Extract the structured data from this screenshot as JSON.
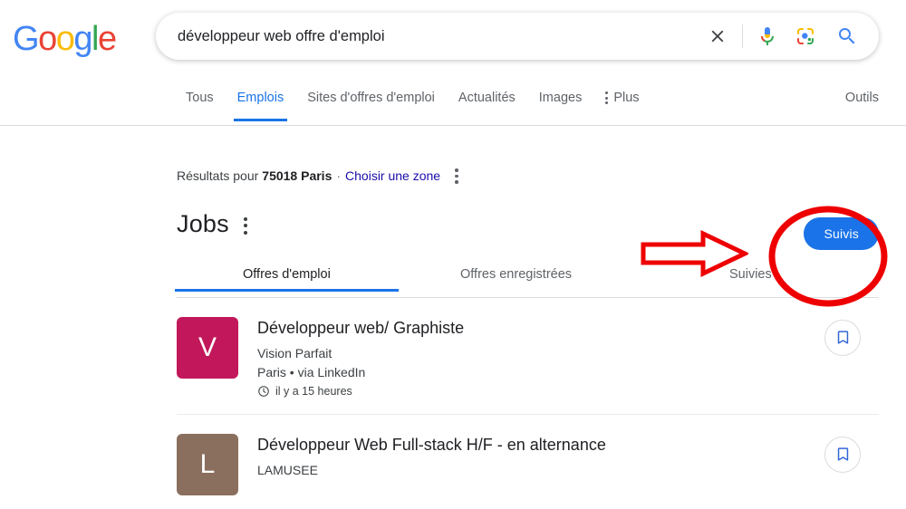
{
  "brand": {
    "logo_letters": [
      "G",
      "o",
      "o",
      "g",
      "l",
      "e"
    ]
  },
  "search": {
    "value": "développeur web offre d'emploi",
    "placeholder": "Rechercher",
    "icons": {
      "clear": "close-icon",
      "voice": "microphone-icon",
      "lens": "google-lens-icon",
      "submit": "search-icon"
    }
  },
  "nav": {
    "tabs": [
      {
        "label": "Tous",
        "active": false
      },
      {
        "label": "Emplois",
        "active": true
      },
      {
        "label": "Sites d'offres d'emploi",
        "active": false
      },
      {
        "label": "Actualités",
        "active": false
      },
      {
        "label": "Images",
        "active": false
      }
    ],
    "more_label": "Plus",
    "tools_label": "Outils"
  },
  "location": {
    "prefix": "Résultats pour",
    "place": "75018 Paris",
    "separator": "·",
    "link": "Choisir une zone"
  },
  "jobs_panel": {
    "title": "Jobs",
    "follow_button": "Suivis",
    "subtabs": [
      {
        "label": "Offres d'emploi",
        "active": true
      },
      {
        "label": "Offres enregistrées",
        "active": false
      },
      {
        "label": "Suivies",
        "active": false
      }
    ],
    "listings": [
      {
        "logo_letter": "V",
        "logo_color": "#C2185B",
        "title": "Développeur web/ Graphiste",
        "company": "Vision Parfait",
        "meta": "Paris • via LinkedIn",
        "posted": "il y a 15 heures",
        "save_icon": "bookmark-icon"
      },
      {
        "logo_letter": "L",
        "logo_color": "#8B6F5E",
        "title": "Développeur Web Full-stack H/F - en alternance",
        "company": "LAMUSEE",
        "meta": "",
        "posted": "",
        "save_icon": "bookmark-icon"
      }
    ]
  },
  "annotations": {
    "highlight_color": "#EE0000",
    "circle": "red-ellipse-highlight",
    "arrow": "red-arrow-pointer"
  },
  "colors": {
    "accent_blue": "#1a73e8",
    "link_blue": "#1a0dab",
    "text_primary": "#202124",
    "text_secondary": "#5f6368",
    "annotation_red": "#EE0000"
  }
}
